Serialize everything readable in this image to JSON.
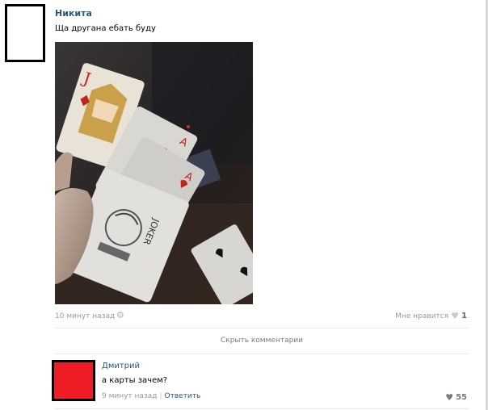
{
  "post": {
    "author": "Никита",
    "text": "Ща другана ебать буду",
    "time": "10 минут назад",
    "likes_label": "Мне нравится",
    "likes_count": "1",
    "photo_description": "playing cards in hand: jack and aces"
  },
  "comments_toggle": "Скрыть комментарии",
  "comment": {
    "author": "Дмитрий",
    "text": "а карты зачем?",
    "time": "9 минут назад",
    "reply_label": "Ответить",
    "likes_count": "55"
  },
  "icons": {
    "settings": "gear-icon",
    "like": "heart-icon"
  },
  "colors": {
    "link": "#2b587a",
    "meta": "#999999",
    "comment_avatar": "#ee1c25"
  }
}
